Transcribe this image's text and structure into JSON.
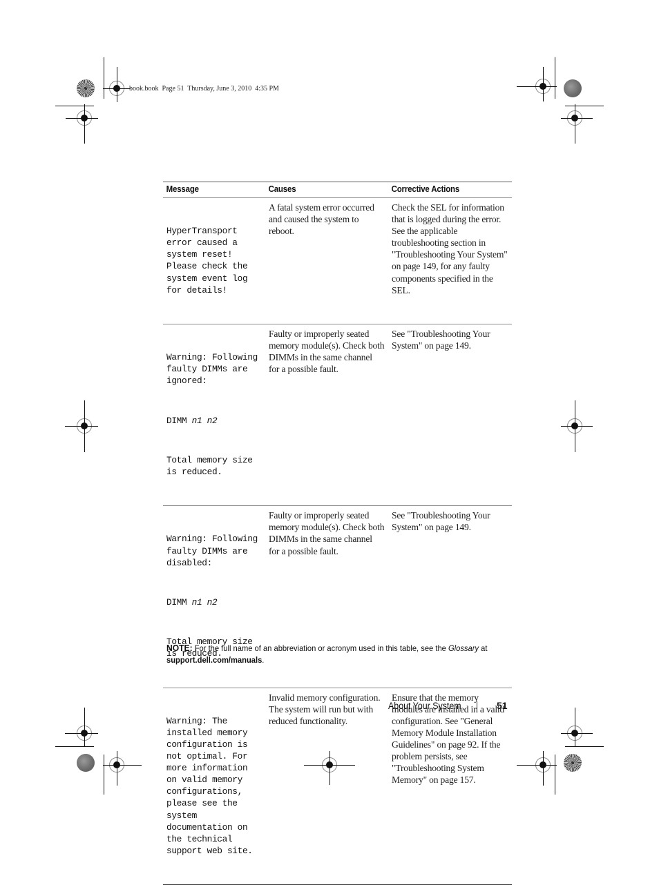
{
  "slug": "book.book  Page 51  Thursday, June 3, 2010  4:35 PM",
  "table": {
    "headers": [
      "Message",
      "Causes",
      "Corrective Actions"
    ],
    "rows": [
      {
        "message": [
          "HyperTransport error caused a system reset! Please check the system event log for details!"
        ],
        "causes": "A fatal system error occurred and caused the system to reboot.",
        "actions": "Check the SEL for information that is logged during the error. See the applicable troubleshooting section in \"Troubleshooting Your System\" on page 149, for any faulty components specified in the SEL."
      },
      {
        "message": [
          "Warning: Following faulty DIMMs are ignored:",
          "DIMM",
          "n1 n2",
          "Total memory size is reduced."
        ],
        "causes": "Faulty or improperly seated memory module(s). Check both DIMMs in the same channel for a possible fault.",
        "actions": "See \"Troubleshooting Your System\" on page 149."
      },
      {
        "message": [
          "Warning: Following faulty DIMMs are disabled:",
          "DIMM",
          "n1 n2",
          "Total memory size is reduced."
        ],
        "causes": "Faulty or improperly seated memory module(s). Check both DIMMs in the same channel for a possible fault.",
        "actions": "See \"Troubleshooting Your System\" on page 149."
      },
      {
        "message": [
          "Warning: The installed memory configuration is not optimal. For more information on valid memory configurations, please see the system documentation on the technical support web site."
        ],
        "causes": "Invalid memory configuration. The system will run but with reduced functionality.",
        "actions": "Ensure that the memory modules are installed in a valid configuration. See \"General Memory Module Installation Guidelines\" on page 92. If the problem persists, see \"Troubleshooting System Memory\" on page 157."
      }
    ]
  },
  "note": {
    "label": "NOTE:",
    "text_before": " For the full name of an abbreviation or acronym used in this table, see the ",
    "glossary": "Glossary",
    "text_at": " at ",
    "link": "support.dell.com/manuals",
    "period": "."
  },
  "footer": {
    "section": "About Your System",
    "page_number": "51"
  },
  "icons": {
    "registration_mark": "crosshair-target-icon",
    "star_target": "starburst-target-icon",
    "grain_dot": "halftone-dot-icon"
  }
}
